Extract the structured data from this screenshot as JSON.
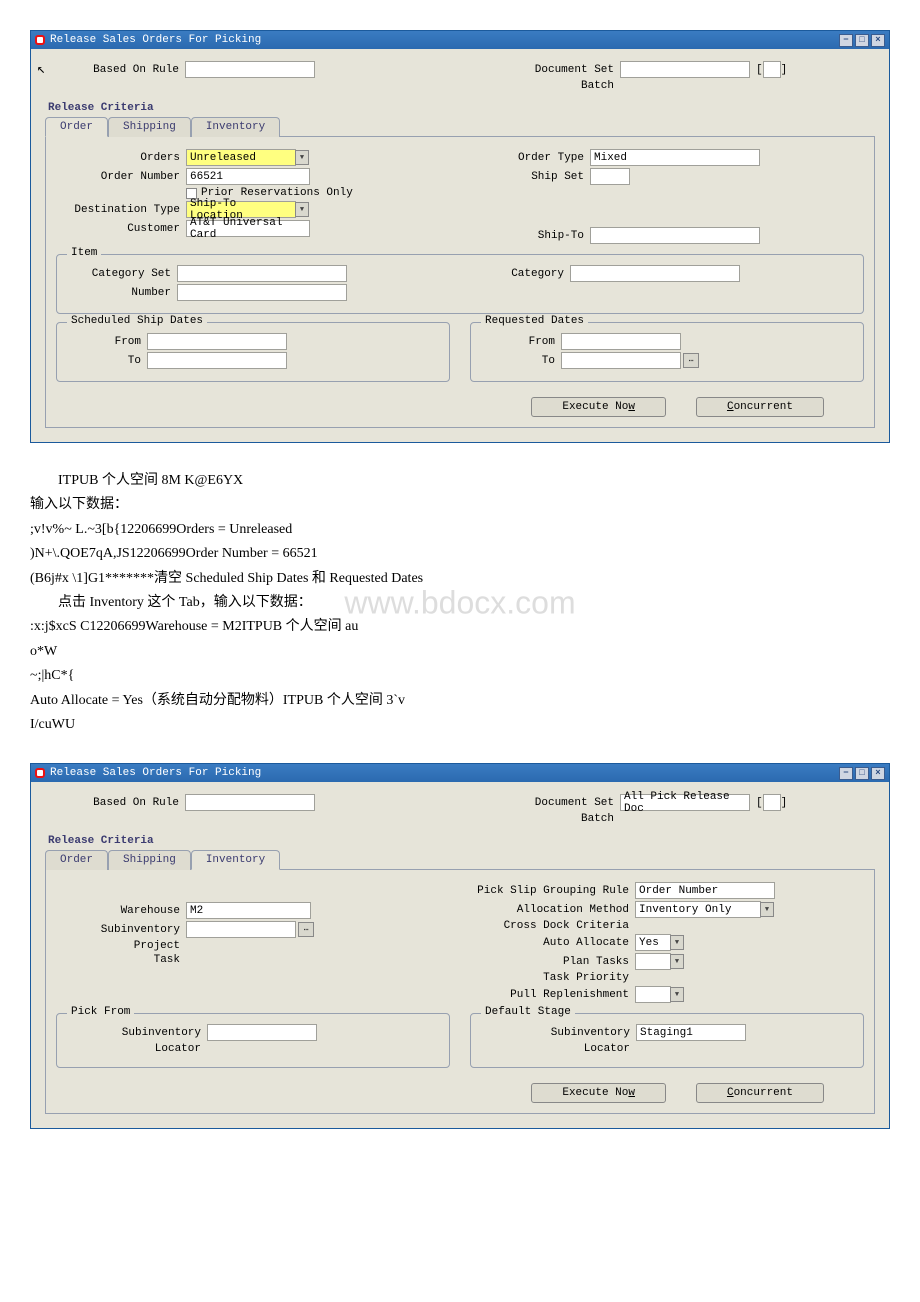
{
  "window1": {
    "title": "Release Sales Orders For Picking",
    "header": {
      "based_on_rule_label": "Based On Rule",
      "document_set_label": "Document Set",
      "document_set_value": "",
      "batch_label": "Batch"
    },
    "release_criteria_label": "Release Criteria",
    "tabs": {
      "order": "Order",
      "shipping": "Shipping",
      "inventory": "Inventory"
    },
    "order_tab": {
      "orders_label": "Orders",
      "orders_value": "Unreleased",
      "order_number_label": "Order Number",
      "order_number_value": "66521",
      "prior_res_label": "Prior Reservations Only",
      "destination_type_label": "Destination Type",
      "destination_type_value": "Ship-To Location",
      "customer_label": "Customer",
      "customer_value": "AT&T Universal Card",
      "order_type_label": "Order Type",
      "order_type_value": "Mixed",
      "ship_set_label": "Ship Set",
      "ship_to_label": "Ship-To"
    },
    "item_group": {
      "title": "Item",
      "category_set_label": "Category Set",
      "number_label": "Number",
      "category_label": "Category"
    },
    "ship_dates": {
      "title": "Scheduled Ship Dates",
      "from_label": "From",
      "to_label": "To"
    },
    "req_dates": {
      "title": "Requested Dates",
      "from_label": "From",
      "to_label": "To"
    },
    "buttons": {
      "execute_now": "Execute Now",
      "concurrent": "Concurrent"
    }
  },
  "text1": {
    "l1": "ITPUB 个人空间 8M K@E6YX",
    "l2": "输入以下数据：",
    "l3": ";v!v%~ L.~3[b{12206699Orders = Unreleased",
    "l4": ")N+\\.QOE7qA,JS12206699Order Number = 66521",
    "l5": "(B6j#x \\1]G1*******清空 Scheduled Ship Dates 和 Requested Dates",
    "l6": "点击 Inventory 这个 Tab，输入以下数据：",
    "l7": ":x:j$xcS C12206699Warehouse = M2ITPUB 个人空间 au",
    "l8": "o*W",
    "l9": "~;|hC*{",
    "l10": "Auto Allocate = Yes（系统自动分配物料）ITPUB 个人空间 3`v",
    "l11": "I/cuWU"
  },
  "watermark_text": "www.bdocx.com",
  "window2": {
    "title": "Release Sales Orders For Picking",
    "header": {
      "based_on_rule_label": "Based On Rule",
      "document_set_label": "Document Set",
      "document_set_value": "All Pick Release Doc",
      "batch_label": "Batch"
    },
    "release_criteria_label": "Release Criteria",
    "tabs": {
      "order": "Order",
      "shipping": "Shipping",
      "inventory": "Inventory"
    },
    "inv_tab": {
      "warehouse_label": "Warehouse",
      "warehouse_value": "M2",
      "subinventory_label": "Subinventory",
      "project_label": "Project",
      "task_label": "Task",
      "pick_slip_label": "Pick Slip Grouping Rule",
      "pick_slip_value": "Order Number",
      "alloc_method_label": "Allocation Method",
      "alloc_method_value": "Inventory Only",
      "cross_dock_label": "Cross Dock Criteria",
      "auto_allocate_label": "Auto Allocate",
      "auto_allocate_value": "Yes",
      "plan_tasks_label": "Plan Tasks",
      "task_priority_label": "Task Priority",
      "pull_repl_label": "Pull Replenishment"
    },
    "pick_from": {
      "title": "Pick From",
      "sub_label": "Subinventory",
      "loc_label": "Locator"
    },
    "default_stage": {
      "title": "Default Stage",
      "sub_label": "Subinventory",
      "sub_value": "Staging1",
      "loc_label": "Locator"
    },
    "buttons": {
      "execute_now": "Execute Now",
      "concurrent": "Concurrent"
    }
  },
  "brackets": {
    "open": "[",
    "close": "]"
  }
}
